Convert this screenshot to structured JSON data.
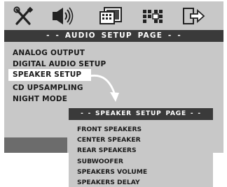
{
  "audio_page": {
    "title": "- -  AUDIO SETUP PAGE  - -",
    "items": [
      "ANALOG OUTPUT",
      "DIGITAL AUDIO SETUP",
      "SPEAKER SETUP",
      "CD UPSAMPLING",
      "NIGHT MODE"
    ],
    "selected_item": "SPEAKER SETUP"
  },
  "icons": [
    "tools-icon",
    "speaker-icon",
    "video-screen-icon",
    "preference-grid-icon",
    "exit-icon"
  ],
  "speaker_page": {
    "title": "- -   SPEAKER SETUP PAGE   - -",
    "items": [
      "FRONT SPEAKERS",
      "CENTER SPEAKER",
      "REAR SPEAKERS",
      "SUBWOOFER",
      "SPEAKERS VOLUME",
      "SPEAKERS DELAY"
    ]
  }
}
